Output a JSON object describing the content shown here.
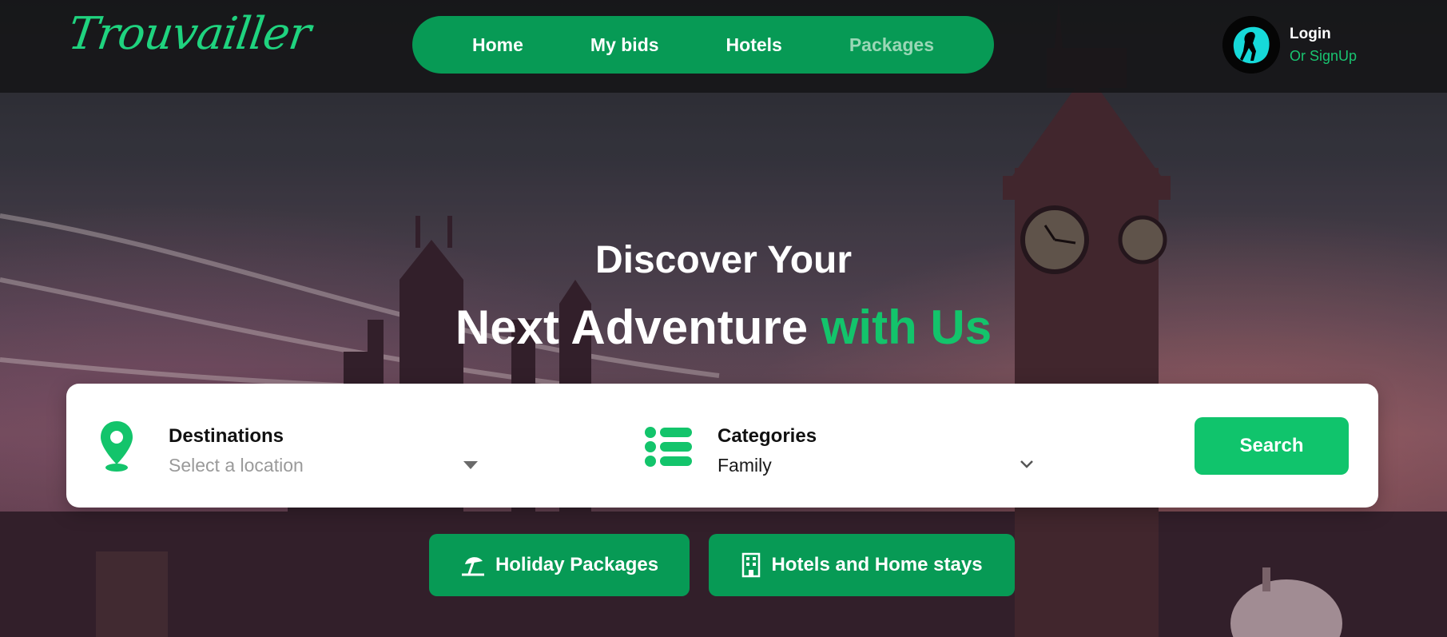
{
  "brand": {
    "logo_text": "Trouvailler",
    "accent_color": "#13c46b",
    "nav_color": "#079a55"
  },
  "nav": {
    "items": [
      {
        "label": "Home"
      },
      {
        "label": "My bids"
      },
      {
        "label": "Hotels"
      },
      {
        "label": "Packages"
      }
    ]
  },
  "account": {
    "login_label": "Login",
    "signup_label": "Or SignUp",
    "avatar_icon": "explorer-avatar-icon"
  },
  "hero": {
    "line1": "Discover Your",
    "line2_main": "Next Adventure",
    "line2_accent": "with Us"
  },
  "search": {
    "destination": {
      "label": "Destinations",
      "placeholder": "Select a location",
      "icon": "map-pin-icon"
    },
    "category": {
      "label": "Categories",
      "value": "Family",
      "icon": "list-icon"
    },
    "button_label": "Search"
  },
  "quick_links": {
    "holiday": {
      "label": "Holiday Packages",
      "icon": "beach-umbrella-icon"
    },
    "hotels": {
      "label": "Hotels and Home stays",
      "icon": "building-icon"
    }
  }
}
